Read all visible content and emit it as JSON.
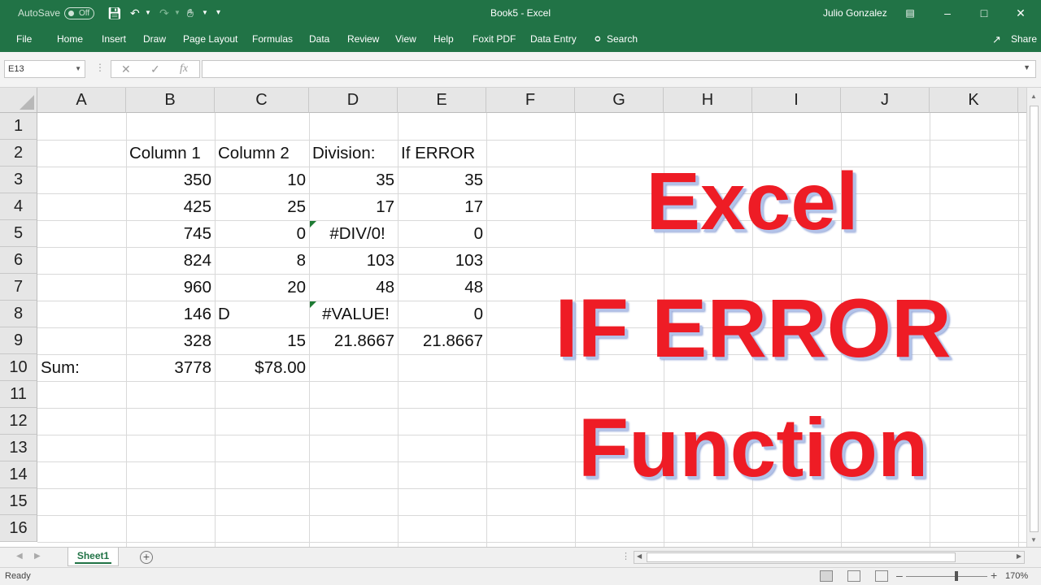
{
  "titlebar": {
    "autosave_label": "AutoSave",
    "autosave_state": "Off",
    "doc_title": "Book5  -  Excel",
    "user_name": "Julio Gonzalez"
  },
  "ribbon_tabs": [
    "File",
    "Home",
    "Insert",
    "Draw",
    "Page Layout",
    "Formulas",
    "Data",
    "Review",
    "View",
    "Help",
    "Foxit PDF",
    "Data Entry",
    "Search"
  ],
  "share_label": "Share",
  "formula_bar": {
    "name_box": "E13",
    "formula": ""
  },
  "columns": [
    "A",
    "B",
    "C",
    "D",
    "E",
    "F",
    "G",
    "H",
    "I",
    "J",
    "K"
  ],
  "rows": [
    "1",
    "2",
    "3",
    "4",
    "5",
    "6",
    "7",
    "8",
    "9",
    "10",
    "11",
    "12",
    "13",
    "14",
    "15",
    "16"
  ],
  "cells": {
    "B2": "Column 1",
    "C2": "Column 2",
    "D2": "Division:",
    "E2": "If ERROR",
    "B3": "350",
    "C3": "10",
    "D3": "35",
    "E3": "35",
    "B4": "425",
    "C4": "25",
    "D4": "17",
    "E4": "17",
    "B5": "745",
    "C5": "0",
    "D5": "#DIV/0!",
    "E5": "0",
    "B6": "824",
    "C6": "8",
    "D6": "103",
    "E6": "103",
    "B7": "960",
    "C7": "20",
    "D7": "48",
    "E7": "48",
    "B8": "146",
    "C8": "D",
    "D8": "#VALUE!",
    "E8": "0",
    "B9": "328",
    "C9": "15",
    "D9": "21.8667",
    "E9": "21.8667",
    "A10": "Sum:",
    "B10": "3778",
    "C10": "$78.00"
  },
  "overlay": {
    "line1": "Excel",
    "line2": "IF ERROR",
    "line3": "Function"
  },
  "sheet_tab": "Sheet1",
  "status": {
    "ready": "Ready",
    "zoom": "170%"
  },
  "colors": {
    "excel_green": "#217346",
    "overlay_red": "#ee1c25"
  }
}
